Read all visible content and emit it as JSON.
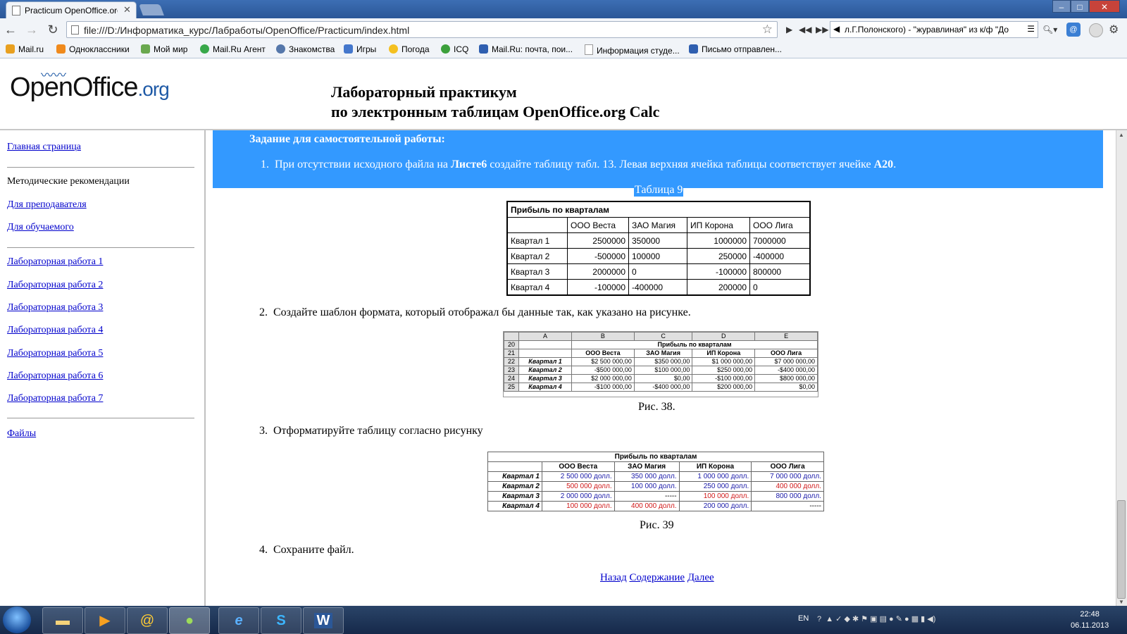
{
  "browser": {
    "tab_title": "Practicum OpenOffice.org",
    "url": "file:///D:/Информатика_курс/Лабработы/OpenOffice/Practicum/index.html",
    "player_text": "л.Г.Полонского) - \"журавлиная\" из к/ф \"До",
    "bookmarks": [
      "Mail.ru",
      "Одноклассники",
      "Мой мир",
      "Mail.Ru Агент",
      "Знакомства",
      "Игры",
      "Погода",
      "ICQ",
      "Mail.Ru: почта, пои...",
      "Информация студе...",
      "Письмо отправлен..."
    ],
    "bookmark_colors": [
      "#e8a020",
      "#f08a1c",
      "#6aa84f",
      "#38a84a",
      "#5577aa",
      "#4477cc",
      "#f4c020",
      "#3ca03c",
      "#2f5fb0",
      "#cccccc",
      "#2f5fb0"
    ]
  },
  "header": {
    "logo_main": "OpenOffice",
    "logo_suffix": ".org",
    "title_line1": "Лабораторный практикум",
    "title_line2": "по электронным таблицам OpenOffice.org Calc"
  },
  "sidebar": {
    "home": "Главная страница",
    "method": "Методические рекомендации",
    "teacher": "Для преподавателя",
    "student": "Для обучаемого",
    "labs": [
      "Лабораторная работа 1",
      "Лабораторная работа 2",
      "Лабораторная работа 3",
      "Лабораторная работа 4",
      "Лабораторная работа 5",
      "Лабораторная работа 6",
      "Лабораторная работа 7"
    ],
    "files": "Файлы"
  },
  "content": {
    "task_heading": "Задание для самостоятельной работы:",
    "item1_num": "1.",
    "item1_a": "При отсутствии исходного файла на ",
    "item1_b": "Листе6",
    "item1_c": " создайте таблицу табл. 13. Левая верхняя ячейка таблицы соответствует ячейке ",
    "item1_d": "А20",
    "item1_e": ".",
    "table_caption": "Таблица 9",
    "table9": {
      "title": "Прибыль по кварталам",
      "headers": [
        "",
        "ООО Веста",
        "ЗАО Магия",
        "ИП Корона",
        "ООО Лига"
      ],
      "rows": [
        [
          "Квартал 1",
          "2500000",
          "350000",
          "1000000",
          "7000000"
        ],
        [
          "Квартал 2",
          "-500000",
          "100000",
          "250000",
          "-400000"
        ],
        [
          "Квартал 3",
          "2000000",
          "0",
          "-100000",
          "800000"
        ],
        [
          "Квартал 4",
          "-100000",
          "-400000",
          "200000",
          "0"
        ]
      ]
    },
    "item2_num": "2.",
    "item2": "Создайте шаблон формата, который отображал бы данные так, как указано на рисунке.",
    "fig38": {
      "cols": [
        "A",
        "B",
        "C",
        "D",
        "E"
      ],
      "row_nums": [
        "20",
        "21",
        "22",
        "23",
        "24",
        "25"
      ],
      "title": "Прибыль по кварталам",
      "headers": [
        "ООО Веста",
        "ЗАО Магия",
        "ИП Корона",
        "ООО Лига"
      ],
      "rows": [
        [
          "Квартал 1",
          "$2 500 000,00",
          "$350 000,00",
          "$1 000 000,00",
          "$7 000 000,00"
        ],
        [
          "Квартал 2",
          "-$500 000,00",
          "$100 000,00",
          "$250 000,00",
          "-$400 000,00"
        ],
        [
          "Квартал 3",
          "$2 000 000,00",
          "$0,00",
          "-$100 000,00",
          "$800 000,00"
        ],
        [
          "Квартал 4",
          "-$100 000,00",
          "-$400 000,00",
          "$200 000,00",
          "$0,00"
        ]
      ]
    },
    "fig38_caption": "Рис. 38.",
    "item3_num": "3.",
    "item3": "Отформатируйте таблицу согласно рисунку",
    "fig39": {
      "title": "Прибыль по кварталам",
      "headers": [
        "ООО Веста",
        "ЗАО Магия",
        "ИП Корона",
        "ООО Лига"
      ],
      "rows": [
        [
          "Квартал 1",
          "2 500 000 долл.",
          "350 000 долл.",
          "1 000 000 долл.",
          "7 000 000 долл."
        ],
        [
          "Квартал 2",
          "500 000 долл.",
          "100 000 долл.",
          "250 000 долл.",
          "400 000 долл."
        ],
        [
          "Квартал 3",
          "2 000 000 долл.",
          "-----",
          "100 000 долл.",
          "800 000 долл."
        ],
        [
          "Квартал 4",
          "100 000 долл.",
          "400 000 долл.",
          "200 000 долл.",
          "-----"
        ]
      ],
      "colors": [
        [
          "blue",
          "blue",
          "blue",
          "blue"
        ],
        [
          "red",
          "blue",
          "blue",
          "red"
        ],
        [
          "blue",
          "black",
          "red",
          "blue"
        ],
        [
          "red",
          "red",
          "blue",
          "black"
        ]
      ]
    },
    "fig39_caption": "Рис. 39",
    "item4_num": "4.",
    "item4": "Сохраните файл.",
    "nav_back": "Назад",
    "nav_contents": "Содержание",
    "nav_next": "Далее"
  },
  "taskbar": {
    "lang": "EN",
    "time": "22:48",
    "date": "06.11.2013"
  }
}
